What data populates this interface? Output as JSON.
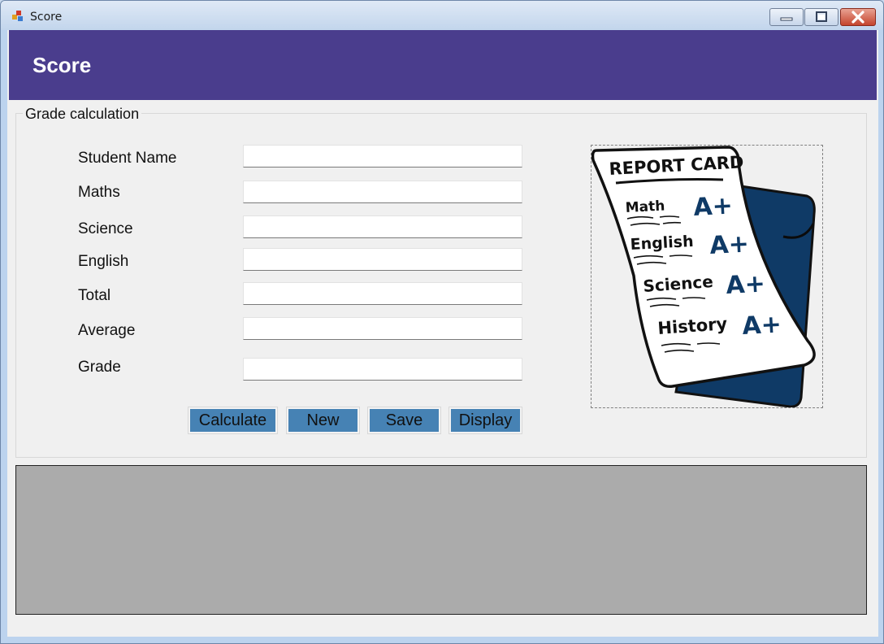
{
  "window": {
    "title": "Score"
  },
  "header": {
    "title": "Score"
  },
  "group": {
    "legend": "Grade calculation"
  },
  "fields": [
    {
      "label": "Student Name",
      "value": ""
    },
    {
      "label": "Maths",
      "value": ""
    },
    {
      "label": "Science",
      "value": ""
    },
    {
      "label": "English",
      "value": ""
    },
    {
      "label": "Total",
      "value": ""
    },
    {
      "label": "Average",
      "value": ""
    },
    {
      "label": "Grade",
      "value": ""
    }
  ],
  "buttons": {
    "calculate": "Calculate",
    "new": "New",
    "save": "Save",
    "display": "Display"
  },
  "report_card": {
    "title": "REPORT CARD",
    "rows": [
      {
        "subject": "Math",
        "grade": "A+"
      },
      {
        "subject": "English",
        "grade": "A+"
      },
      {
        "subject": "Science",
        "grade": "A+"
      },
      {
        "subject": "History",
        "grade": "A+"
      }
    ]
  },
  "colors": {
    "header": "#4a3d8d",
    "button": "#4682b4",
    "panel": "#ababab",
    "folder": "#0f3a66"
  }
}
